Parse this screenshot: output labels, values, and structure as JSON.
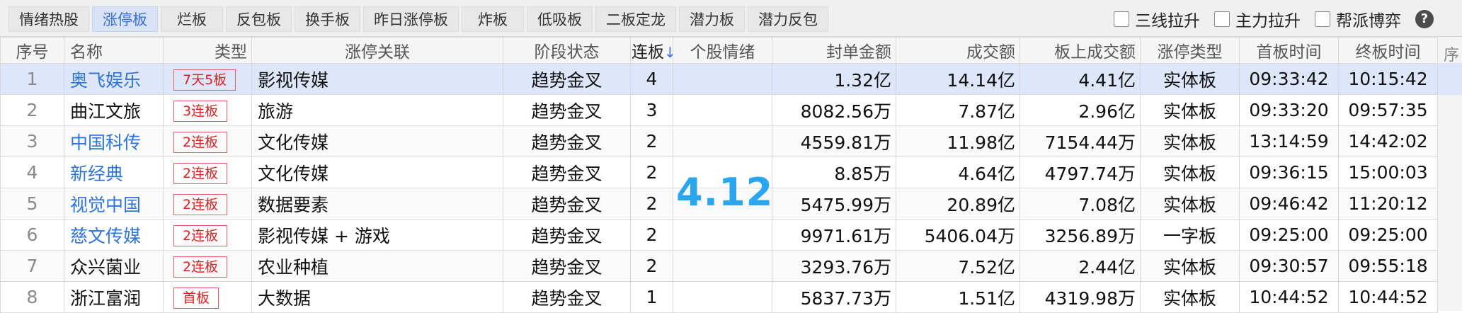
{
  "tabs": [
    {
      "label": "情绪热股",
      "active": false
    },
    {
      "label": "涨停板",
      "active": true
    },
    {
      "label": "烂板",
      "active": false
    },
    {
      "label": "反包板",
      "active": false
    },
    {
      "label": "换手板",
      "active": false
    },
    {
      "label": "昨日涨停板",
      "active": false
    },
    {
      "label": "炸板",
      "active": false
    },
    {
      "label": "低吸板",
      "active": false
    },
    {
      "label": "二板定龙",
      "active": false
    },
    {
      "label": "潜力板",
      "active": false
    },
    {
      "label": "潜力反包",
      "active": false
    }
  ],
  "checks": [
    "三线拉升",
    "主力拉升",
    "帮派博弈"
  ],
  "help": "?",
  "columns": [
    "序号",
    "名称",
    "类型",
    "涨停关联",
    "阶段状态",
    "连板",
    "个股情绪",
    "封单金额",
    "成交额",
    "板上成交额",
    "涨停类型",
    "首板时间",
    "终板时间"
  ],
  "sort_arrow": "↓",
  "rows": [
    {
      "no": "1",
      "name": "奥飞娱乐",
      "blue": true,
      "badge": "7天5板",
      "sector": "影视传媒",
      "stage": "趋势金叉",
      "boards": "4",
      "seal": "1.32亿",
      "turnover": "14.14亿",
      "onboard": "4.41亿",
      "type": "实体板",
      "first": "09:33:42",
      "last": "10:15:42"
    },
    {
      "no": "2",
      "name": "曲江文旅",
      "blue": false,
      "badge": "3连板",
      "sector": "旅游",
      "stage": "趋势金叉",
      "boards": "3",
      "seal": "8082.56万",
      "turnover": "7.87亿",
      "onboard": "2.96亿",
      "type": "实体板",
      "first": "09:33:20",
      "last": "09:57:35"
    },
    {
      "no": "3",
      "name": "中国科传",
      "blue": true,
      "badge": "2连板",
      "sector": "文化传媒",
      "stage": "趋势金叉",
      "boards": "2",
      "seal": "4559.81万",
      "turnover": "11.98亿",
      "onboard": "7154.44万",
      "type": "实体板",
      "first": "13:14:59",
      "last": "14:42:02"
    },
    {
      "no": "4",
      "name": "新经典",
      "blue": true,
      "badge": "2连板",
      "sector": "文化传媒",
      "stage": "趋势金叉",
      "boards": "2",
      "seal": "8.85万",
      "turnover": "4.64亿",
      "onboard": "4797.74万",
      "type": "实体板",
      "first": "09:36:15",
      "last": "15:00:03"
    },
    {
      "no": "5",
      "name": "视觉中国",
      "blue": true,
      "badge": "2连板",
      "sector": "数据要素",
      "stage": "趋势金叉",
      "boards": "2",
      "seal": "5475.99万",
      "turnover": "20.89亿",
      "onboard": "7.08亿",
      "type": "实体板",
      "first": "09:46:42",
      "last": "11:20:12"
    },
    {
      "no": "6",
      "name": "慈文传媒",
      "blue": true,
      "badge": "2连板",
      "sector": "影视传媒 + 游戏",
      "stage": "趋势金叉",
      "boards": "2",
      "seal": "9971.61万",
      "turnover": "5406.04万",
      "onboard": "3256.89万",
      "type": "一字板",
      "first": "09:25:00",
      "last": "09:25:00"
    },
    {
      "no": "7",
      "name": "众兴菌业",
      "blue": false,
      "badge": "2连板",
      "sector": "农业种植",
      "stage": "趋势金叉",
      "boards": "2",
      "seal": "3293.76万",
      "turnover": "7.52亿",
      "onboard": "2.44亿",
      "type": "实体板",
      "first": "09:30:57",
      "last": "09:55:18"
    },
    {
      "no": "8",
      "name": "浙江富润",
      "blue": false,
      "badge": "首板",
      "sector": "大数据",
      "stage": "趋势金叉",
      "boards": "1",
      "seal": "5837.73万",
      "turnover": "1.51亿",
      "onboard": "4319.98万",
      "type": "实体板",
      "first": "10:44:52",
      "last": "10:44:52"
    }
  ],
  "overlay_date": "4.12",
  "right_strip_header": "序"
}
